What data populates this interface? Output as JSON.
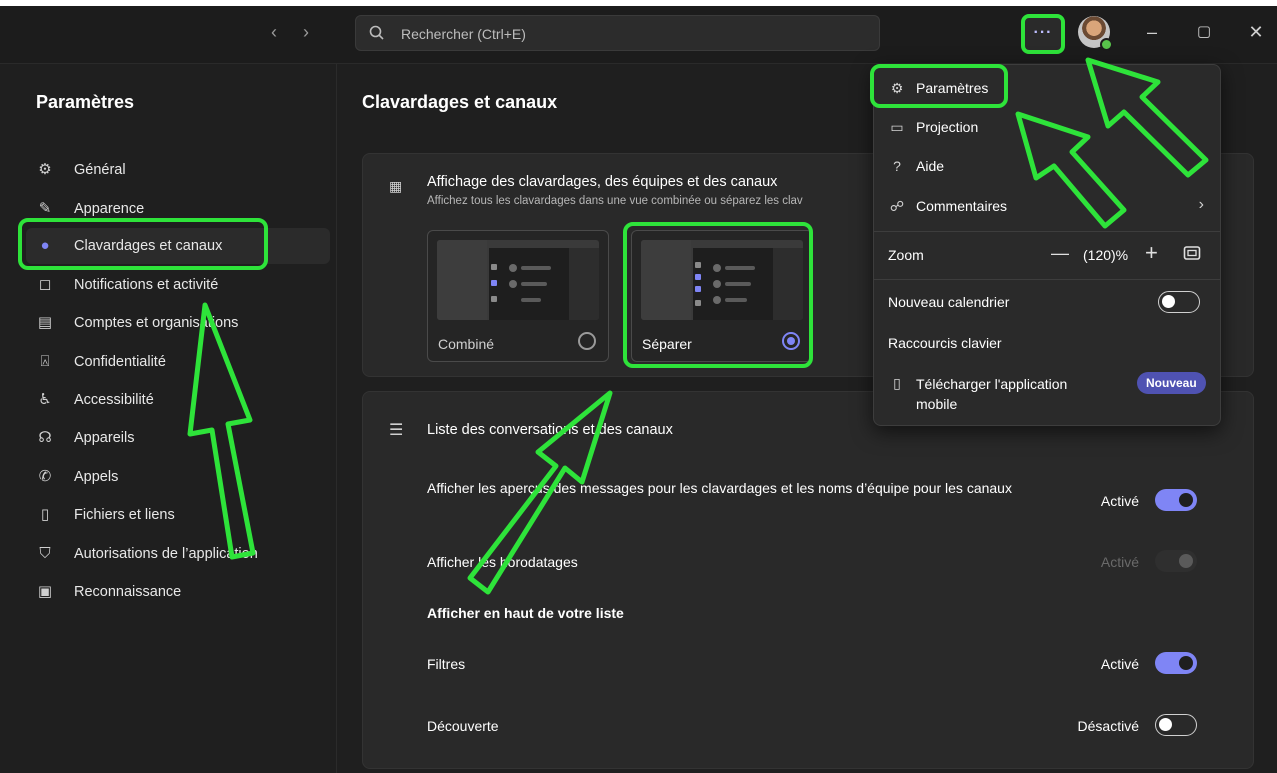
{
  "topbar": {
    "back_icon": "chevron-left-icon",
    "forward_icon": "chevron-right-icon",
    "search_placeholder": "Rechercher (Ctrl+E)",
    "more_label": "···",
    "minimize": "–",
    "restore": "▢",
    "close": "✕"
  },
  "sidebar": {
    "title": "Paramètres",
    "items": [
      {
        "label": "Général",
        "icon": "gear-icon"
      },
      {
        "label": "Apparence",
        "icon": "magic-wand-icon"
      },
      {
        "label": "Clavardages et canaux",
        "icon": "chat-icon",
        "active": true
      },
      {
        "label": "Notifications et activité",
        "icon": "bell-icon"
      },
      {
        "label": "Comptes et organisations",
        "icon": "id-card-icon"
      },
      {
        "label": "Confidentialité",
        "icon": "lock-icon"
      },
      {
        "label": "Accessibilité",
        "icon": "accessibility-icon"
      },
      {
        "label": "Appareils",
        "icon": "headset-icon"
      },
      {
        "label": "Appels",
        "icon": "phone-icon"
      },
      {
        "label": "Fichiers et liens",
        "icon": "file-icon"
      },
      {
        "label": "Autorisations de l’application",
        "icon": "shield-icon"
      },
      {
        "label": "Reconnaissance",
        "icon": "badge-icon"
      }
    ]
  },
  "main": {
    "title": "Clavardages et canaux",
    "display": {
      "heading": "Affichage des clavardages, des équipes et des canaux",
      "subtext": "Affichez tous les clavardages dans une vue combinée ou séparez les clav",
      "options": [
        {
          "label": "Combiné",
          "selected": false
        },
        {
          "label": "Séparer",
          "selected": true
        }
      ]
    },
    "list": {
      "heading": "Liste des conversations et des canaux",
      "settings": [
        {
          "label": "Afficher les aperçus des messages pour les clavardages et les noms d’équipe pour les canaux",
          "state": "Activé",
          "on": true
        },
        {
          "label": "Afficher les horodatages",
          "state": "Activé",
          "on": true,
          "disabled": true
        }
      ],
      "section": "Afficher en haut de votre liste",
      "top_settings": [
        {
          "label": "Filtres",
          "state": "Activé",
          "on": true
        },
        {
          "label": "Découverte",
          "state": "Désactivé",
          "on": false
        }
      ]
    }
  },
  "menu": {
    "items": [
      {
        "label": "Paramètres",
        "icon": "gear-icon"
      },
      {
        "label": "Projection",
        "icon": "cast-icon"
      },
      {
        "label": "Aide",
        "icon": "help-icon"
      },
      {
        "label": "Commentaires",
        "icon": "feedback-icon",
        "chevron": "›"
      }
    ],
    "zoom_label": "Zoom",
    "zoom_minus": "—",
    "zoom_value": "(120)%",
    "zoom_plus": "+",
    "new_calendar": "Nouveau calendrier",
    "shortcuts": "Raccourcis clavier",
    "download_app": "Télécharger l'application mobile",
    "badge": "Nouveau"
  },
  "accent": "#7f85f5",
  "highlight": "#2ee33a"
}
